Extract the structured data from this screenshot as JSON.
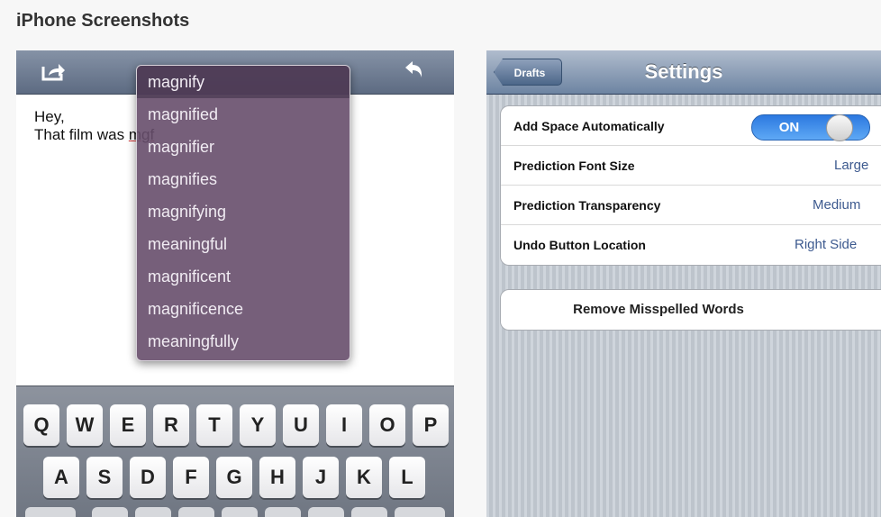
{
  "section_title": "iPhone Screenshots",
  "editor": {
    "toolbar": {
      "share_icon": "share-icon",
      "undo_icon": "undo-icon"
    },
    "note_lines": [
      "Hey,",
      "That film was ",
      "mgf"
    ],
    "suggestions": [
      "magnify",
      "magnified",
      "magnifier",
      "magnifies",
      "magnifying",
      "meaningful",
      "magnificent",
      "magnificence",
      "meaningfully"
    ],
    "keyboard": {
      "row1": [
        "Q",
        "W",
        "E",
        "R",
        "T",
        "Y",
        "U",
        "I",
        "O",
        "P"
      ],
      "row2": [
        "A",
        "S",
        "D",
        "F",
        "G",
        "H",
        "J",
        "K",
        "L"
      ]
    }
  },
  "settings": {
    "back_label": "Drafts",
    "title": "Settings",
    "rows": [
      {
        "label": "Add Space Automatically",
        "value": "ON"
      },
      {
        "label": "Prediction Font Size",
        "value": "Large"
      },
      {
        "label": "Prediction Transparency",
        "value": "Medium"
      },
      {
        "label": "Undo Button Location",
        "value": "Right Side"
      }
    ],
    "remove_label": "Remove Misspelled Words"
  },
  "colors": {
    "suggestion_popup": "#674e6c",
    "toggle_on": "#2b78e0",
    "setting_value": "#3d5a8f"
  }
}
